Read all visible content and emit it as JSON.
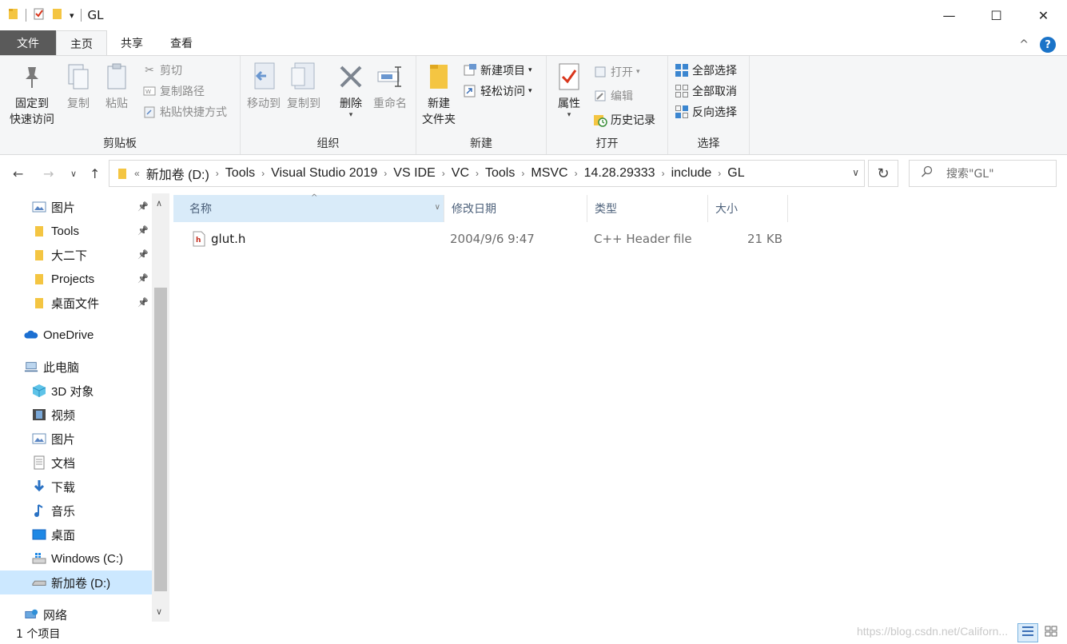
{
  "window": {
    "title": "GL",
    "controls": {
      "minimize": "—",
      "maximize": "☐",
      "close": "✕"
    },
    "quick_access_dropdown": "▾"
  },
  "tabs": {
    "file": "文件",
    "home": "主页",
    "share": "共享",
    "view": "查看",
    "collapse": "^",
    "help": "?"
  },
  "ribbon": {
    "clipboard": {
      "label": "剪贴板",
      "pin_line1": "固定到",
      "pin_line2": "快速访问",
      "copy": "复制",
      "paste": "粘贴",
      "cut": "剪切",
      "copy_path": "复制路径",
      "paste_shortcut": "粘贴快捷方式"
    },
    "organize": {
      "label": "组织",
      "move_to": "移动到",
      "copy_to": "复制到",
      "delete": "删除",
      "rename": "重命名"
    },
    "new": {
      "label": "新建",
      "new_folder_line1": "新建",
      "new_folder_line2": "文件夹",
      "new_item": "新建项目",
      "easy_access": "轻松访问"
    },
    "open": {
      "label": "打开",
      "properties": "属性",
      "open": "打开",
      "edit": "编辑",
      "history": "历史记录"
    },
    "select": {
      "label": "选择",
      "select_all": "全部选择",
      "select_none": "全部取消",
      "invert": "反向选择"
    }
  },
  "address": {
    "overflow": "«",
    "crumbs": [
      "新加卷 (D:)",
      "Tools",
      "Visual Studio 2019",
      "VS IDE",
      "VC",
      "Tools",
      "MSVC",
      "14.28.29333",
      "include",
      "GL"
    ],
    "search_placeholder": "搜索\"GL\""
  },
  "navpane": {
    "items": [
      {
        "label": "图片",
        "pinned": true
      },
      {
        "label": "Tools",
        "pinned": true
      },
      {
        "label": "大二下",
        "pinned": true
      },
      {
        "label": "Projects",
        "pinned": true
      },
      {
        "label": "桌面文件",
        "pinned": true
      },
      {
        "label": "OneDrive"
      },
      {
        "label": "此电脑"
      },
      {
        "label": "3D 对象"
      },
      {
        "label": "视频"
      },
      {
        "label": "图片"
      },
      {
        "label": "文档"
      },
      {
        "label": "下载"
      },
      {
        "label": "音乐"
      },
      {
        "label": "桌面"
      },
      {
        "label": "Windows (C:)"
      },
      {
        "label": "新加卷 (D:)",
        "selected": true
      },
      {
        "label": "网络"
      }
    ]
  },
  "columns": {
    "name": "名称",
    "modified": "修改日期",
    "type": "类型",
    "size": "大小"
  },
  "files": [
    {
      "name": "glut.h",
      "modified": "2004/9/6 9:47",
      "type": "C++ Header file",
      "size": "21 KB"
    }
  ],
  "status": {
    "count": "1 个项目",
    "watermark": "https://blog.csdn.net/Californ..."
  },
  "colors": {
    "accent": "#1a73c8",
    "selected": "#cce8ff",
    "header_sort": "#d9ebf9",
    "folder": "#f4c542"
  }
}
